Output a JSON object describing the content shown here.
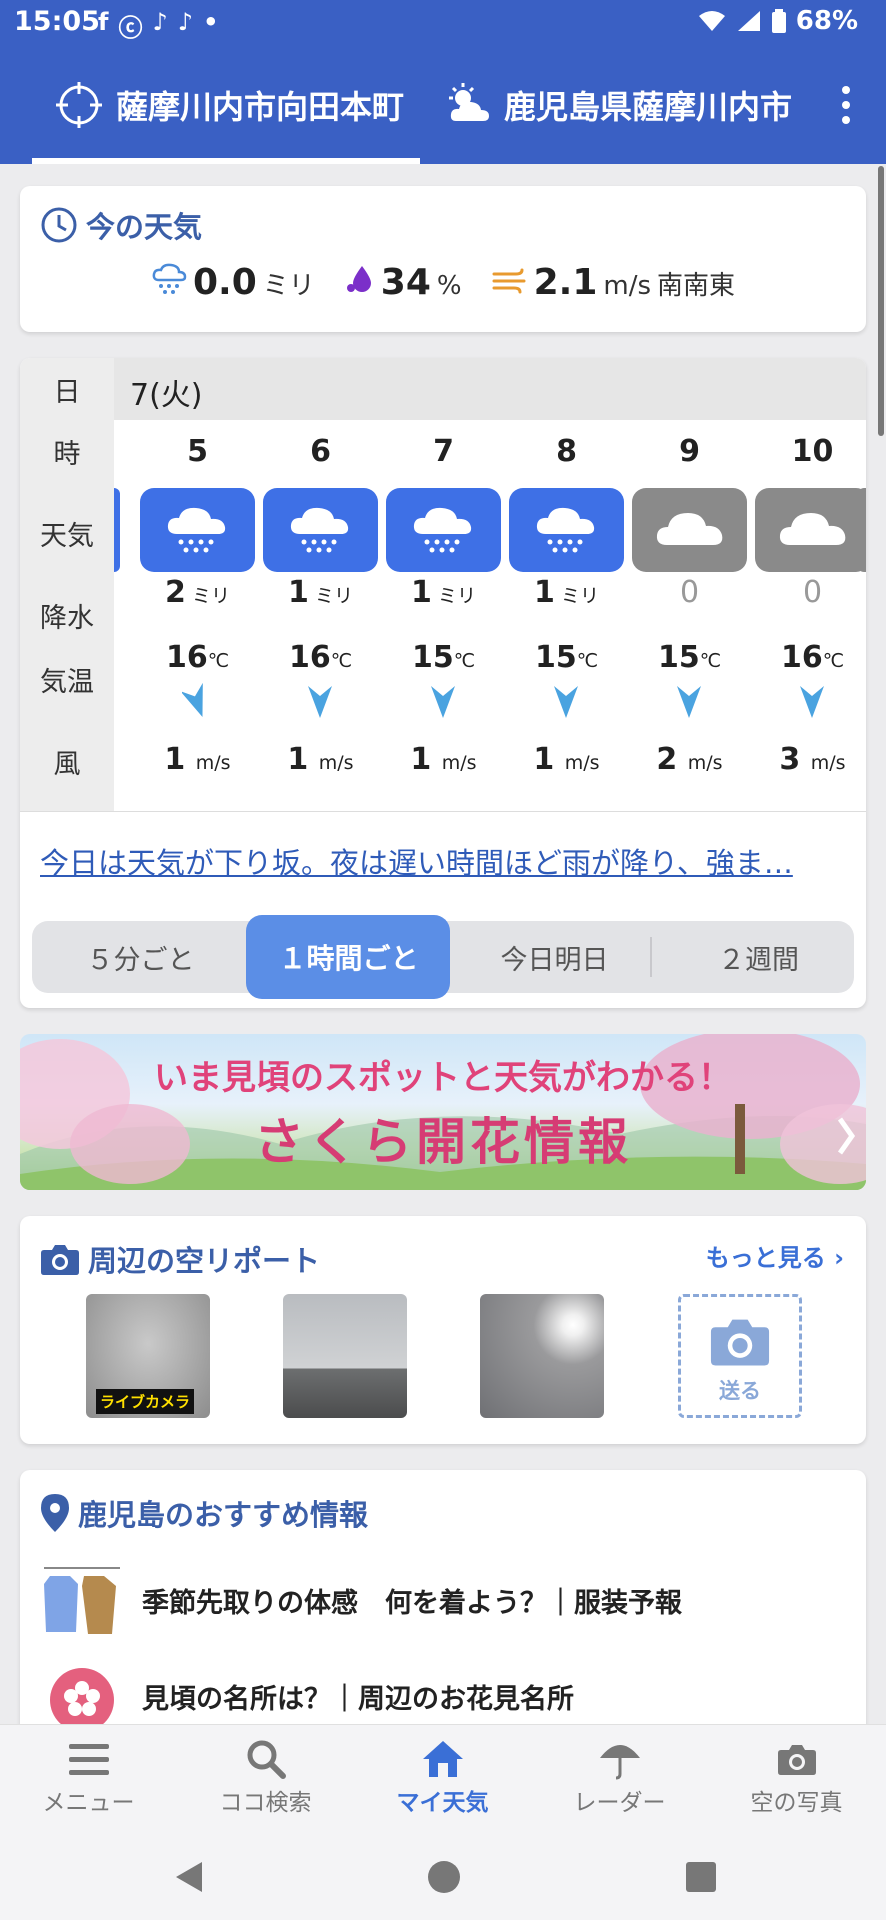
{
  "status": {
    "time": "15:05",
    "apps": [
      "f",
      "ⓒ",
      "♪",
      "♪",
      "•"
    ],
    "battery": "68%"
  },
  "header": {
    "tab1_label": "薩摩川内市向田本町",
    "tab2_label": "鹿児島県薩摩川内市"
  },
  "now": {
    "title": "今の天気",
    "precip_value": "0.0",
    "precip_unit": "ミリ",
    "humidity_value": "34",
    "humidity_unit": "%",
    "wind_value": "2.1",
    "wind_unit": "m/s",
    "wind_dir": "南南東"
  },
  "hourly": {
    "labels": {
      "day": "日",
      "hour": "時",
      "weather": "天気",
      "precip": "降水",
      "temp": "気温",
      "wind": "風"
    },
    "date": "7(火)",
    "hours": [
      {
        "hour": "5",
        "weather": "rain",
        "precip": "2",
        "precip_unit": "ミリ",
        "temp": "16",
        "temp_unit": "℃",
        "wind": "1",
        "wind_unit": "m/s"
      },
      {
        "hour": "6",
        "weather": "rain",
        "precip": "1",
        "precip_unit": "ミリ",
        "temp": "16",
        "temp_unit": "℃",
        "wind": "1",
        "wind_unit": "m/s"
      },
      {
        "hour": "7",
        "weather": "rain",
        "precip": "1",
        "precip_unit": "ミリ",
        "temp": "15",
        "temp_unit": "℃",
        "wind": "1",
        "wind_unit": "m/s"
      },
      {
        "hour": "8",
        "weather": "rain",
        "precip": "1",
        "precip_unit": "ミリ",
        "temp": "15",
        "temp_unit": "℃",
        "wind": "1",
        "wind_unit": "m/s"
      },
      {
        "hour": "9",
        "weather": "cloudy",
        "precip": "0",
        "precip_unit": "",
        "temp": "15",
        "temp_unit": "℃",
        "wind": "2",
        "wind_unit": "m/s"
      },
      {
        "hour": "10",
        "weather": "cloudy",
        "precip": "0",
        "precip_unit": "",
        "temp": "16",
        "temp_unit": "℃",
        "wind": "3",
        "wind_unit": "m/s"
      }
    ],
    "summary": "今日は天気が下り坂。夜は遅い時間ほど雨が降り、強ま…",
    "segments": [
      "５分ごと",
      "１時間ごと",
      "今日明日",
      "２週間"
    ],
    "active_segment": 1
  },
  "banner": {
    "subtitle": "いま見頃のスポットと天気がわかる！",
    "title": "さくら開花情報"
  },
  "photos": {
    "title": "周辺の空リポート",
    "more": "もっと見る",
    "live_badge": "ライブカメラ",
    "send_label": "送る"
  },
  "reco": {
    "title": "鹿児島のおすすめ情報",
    "item1": "季節先取りの体感　何を着よう？｜服装予報",
    "item2": "見頃の名所は？｜周辺のお花見名所"
  },
  "bottomnav": [
    "メニュー",
    "ココ検索",
    "マイ天気",
    "レーダー",
    "空の写真"
  ],
  "colors": {
    "brand": "#3a60c4",
    "rain_tile": "#3e70e6",
    "cloud_tile": "#8a8a8a",
    "accent": "#3a6fd6"
  }
}
